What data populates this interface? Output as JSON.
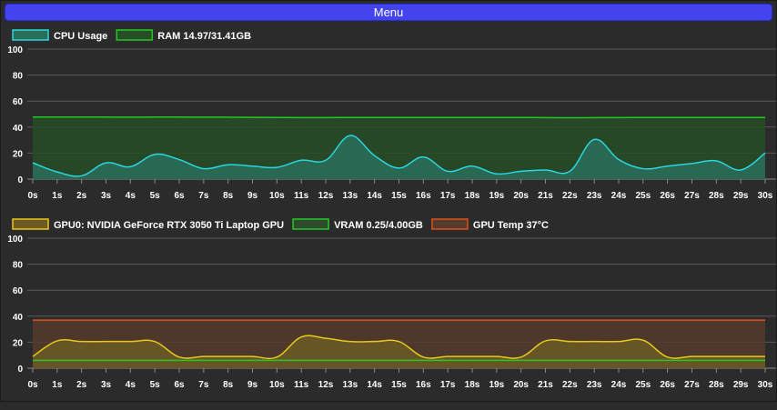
{
  "menu": {
    "label": "Menu"
  },
  "chart_data": [
    {
      "type": "area",
      "x": [
        "0s",
        "1s",
        "2s",
        "3s",
        "4s",
        "5s",
        "6s",
        "7s",
        "8s",
        "9s",
        "10s",
        "11s",
        "12s",
        "13s",
        "14s",
        "15s",
        "16s",
        "17s",
        "18s",
        "19s",
        "20s",
        "21s",
        "22s",
        "23s",
        "24s",
        "25s",
        "26s",
        "27s",
        "28s",
        "29s",
        "30s"
      ],
      "ylim": [
        0,
        100
      ],
      "yticks": [
        0,
        20,
        40,
        60,
        80,
        100
      ],
      "grid": true,
      "legend": "top-left",
      "series": [
        {
          "name": "RAM 14.97/31.41GB",
          "color": "#22c922",
          "fill": "#274d27",
          "values": [
            47.7,
            47.7,
            47.7,
            47.7,
            47.6,
            47.7,
            47.7,
            47.6,
            47.6,
            47.5,
            47.4,
            47.3,
            47.3,
            47.4,
            47.4,
            47.4,
            47.4,
            47.4,
            47.4,
            47.4,
            47.4,
            47.3,
            47.2,
            47.3,
            47.3,
            47.4,
            47.4,
            47.4,
            47.4,
            47.4,
            47.4
          ]
        },
        {
          "name": "CPU Usage",
          "color": "#2ad6e0",
          "fill": "#2a6e5a",
          "values": [
            12.5,
            5.5,
            2.5,
            12.5,
            9.5,
            19,
            15,
            8,
            11,
            10,
            9,
            14.5,
            14.5,
            33.5,
            18,
            8.5,
            17,
            6,
            10,
            4,
            6,
            7,
            6,
            30.5,
            15,
            8,
            10,
            12,
            14,
            7,
            20
          ]
        }
      ]
    },
    {
      "type": "area",
      "x": [
        "0s",
        "1s",
        "2s",
        "3s",
        "4s",
        "5s",
        "6s",
        "7s",
        "8s",
        "9s",
        "10s",
        "11s",
        "12s",
        "13s",
        "14s",
        "15s",
        "16s",
        "17s",
        "18s",
        "19s",
        "20s",
        "21s",
        "22s",
        "23s",
        "24s",
        "25s",
        "26s",
        "27s",
        "28s",
        "29s",
        "30s"
      ],
      "ylim": [
        0,
        100
      ],
      "yticks": [
        0,
        20,
        40,
        60,
        80,
        100
      ],
      "grid": true,
      "legend": "top-left",
      "series": [
        {
          "name": "GPU Temp 37°C",
          "color": "#e0501c",
          "fill": "#553b2c",
          "values": [
            37,
            37,
            37,
            37,
            37,
            37,
            37,
            37,
            37,
            37,
            37,
            37,
            37,
            37,
            37,
            37,
            37,
            37,
            37,
            37,
            37,
            37,
            37,
            37,
            37,
            37,
            37,
            37,
            37,
            37,
            37
          ]
        },
        {
          "name": "GPU0: NVIDIA GeForce RTX 3050 Ti Laptop GPU",
          "color": "#e8c81a",
          "fill": "#6b5a24",
          "values": [
            9,
            21,
            20.5,
            20.5,
            20.5,
            20.5,
            8.5,
            9,
            9,
            9,
            8.5,
            24,
            23,
            20.5,
            20.5,
            20.5,
            8.5,
            9,
            9,
            9,
            8.5,
            21,
            20.5,
            20.5,
            20.5,
            21.5,
            8.5,
            9,
            9,
            9,
            9
          ]
        },
        {
          "name": "VRAM 0.25/4.00GB",
          "color": "#22c922",
          "fill": "none",
          "values": [
            6,
            6,
            6,
            6,
            6,
            6,
            6,
            6,
            6,
            6,
            6,
            6,
            6,
            6,
            6,
            6,
            6,
            6,
            6,
            6,
            6,
            6,
            6,
            6,
            6,
            6,
            6,
            6,
            6,
            6,
            6
          ]
        }
      ]
    }
  ]
}
